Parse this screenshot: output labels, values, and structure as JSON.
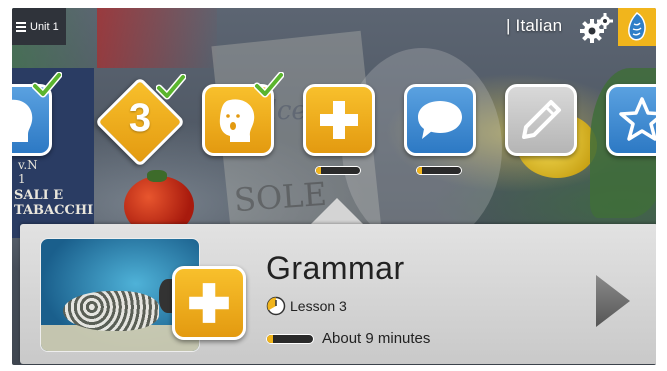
{
  "header": {
    "unit_label": "Unit 1",
    "language_label": "| Italian"
  },
  "path": {
    "current_unit_number": "3",
    "items": [
      {
        "name": "lesson-1",
        "completed": true
      },
      {
        "name": "unit-milestone",
        "completed": true
      },
      {
        "name": "lesson-pronunciation",
        "completed": true
      },
      {
        "name": "lesson-grammar",
        "completed": false,
        "progress": 0.12
      },
      {
        "name": "lesson-conversation",
        "completed": false,
        "progress": 0.12
      },
      {
        "name": "lesson-writing",
        "completed": false
      },
      {
        "name": "lesson-review",
        "completed": false
      }
    ]
  },
  "background": {
    "sign_number": "v.N\n1",
    "sign_text": "SALI E\nTABACCHI",
    "sole_text": "SOLE",
    "dolce_text": "Dolce"
  },
  "detail": {
    "title": "Grammar",
    "lesson_label": "Lesson 3",
    "duration_label": "About 9 minutes",
    "progress": 0.12
  },
  "colors": {
    "accent_orange": "#f1b51c",
    "tile_blue": "#2d79c4",
    "check_green": "#5bb52e"
  }
}
